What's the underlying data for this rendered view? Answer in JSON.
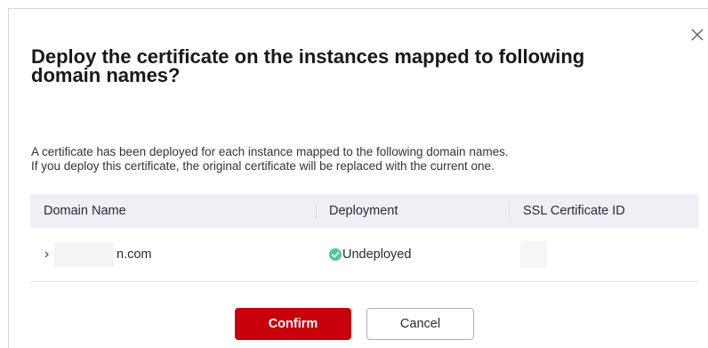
{
  "dialog": {
    "title": "Deploy the certificate on the instances mapped to following domain names?",
    "description": [
      "A certificate has been deployed for each instance mapped to the following domain names.",
      "If you deploy this certificate, the original certificate will be replaced with the current one."
    ],
    "close_icon": "close-icon"
  },
  "table": {
    "columns": [
      "Domain Name",
      "Deployment",
      "SSL Certificate ID"
    ],
    "rows": [
      {
        "domain": "n.com",
        "deployment": "Undeployed",
        "certificate_id": ""
      }
    ]
  },
  "footer": {
    "confirm_label": "Confirm",
    "cancel_label": "Cancel"
  },
  "colors": {
    "primary": "#c7000b",
    "success": "#50c99a",
    "header_bg": "#eef0f5"
  }
}
